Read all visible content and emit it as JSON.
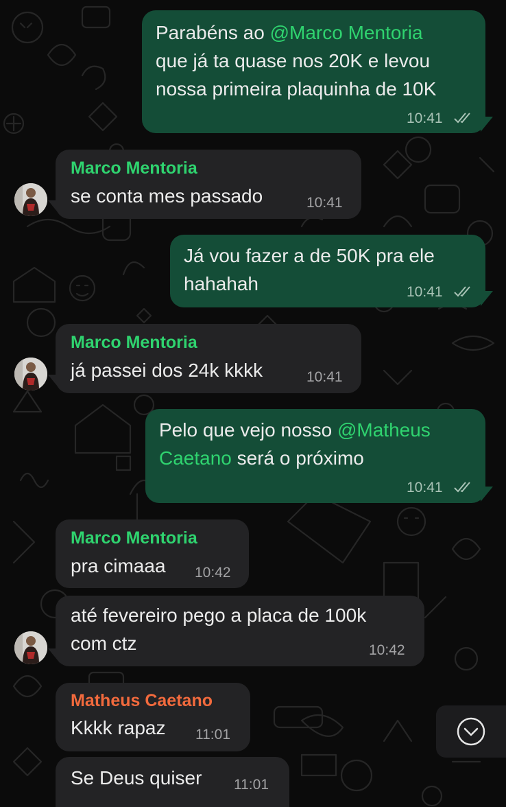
{
  "messages": [
    {
      "direction": "outgoing",
      "text_parts": [
        "Parabéns ao ",
        "@Marco Mentoria",
        "que já ta quase nos 20K e levou",
        "nossa primeira plaquinha de 10K"
      ],
      "time": "10:41",
      "status": "read"
    },
    {
      "direction": "incoming",
      "sender": "Marco Mentoria",
      "text": "se conta mes passado",
      "time": "10:41"
    },
    {
      "direction": "outgoing",
      "text_lines": [
        "Já vou fazer a de 50K pra ele",
        "hahahah"
      ],
      "time": "10:41",
      "status": "read"
    },
    {
      "direction": "incoming",
      "sender": "Marco Mentoria",
      "text": "já passei dos 24k kkkk",
      "time": "10:41"
    },
    {
      "direction": "outgoing",
      "text_parts": [
        "Pelo que vejo nosso ",
        "@Matheus",
        "Caetano",
        " será o próximo"
      ],
      "time": "10:41",
      "status": "read"
    },
    {
      "direction": "incoming",
      "sender": "Marco Mentoria",
      "text": "pra cimaaa",
      "time": "10:42"
    },
    {
      "direction": "incoming",
      "text_lines": [
        "até fevereiro pego a placa de 100k",
        "com ctz"
      ],
      "time": "10:42"
    },
    {
      "direction": "incoming",
      "sender": "Matheus Caetano",
      "text": "Kkkk rapaz",
      "time": "11:01"
    },
    {
      "direction": "incoming",
      "text": "Se Deus quiser",
      "time": "11:01"
    }
  ],
  "colors": {
    "outgoing_bubble": "#144d37",
    "incoming_bubble": "#232325",
    "mention": "#2fd36f",
    "sender_marco": "#2fd36f",
    "sender_matheus": "#f26a3d",
    "read_ticks": "#a9c3b6"
  },
  "scroll_button": {
    "icon": "chevron-down-circle-icon"
  }
}
